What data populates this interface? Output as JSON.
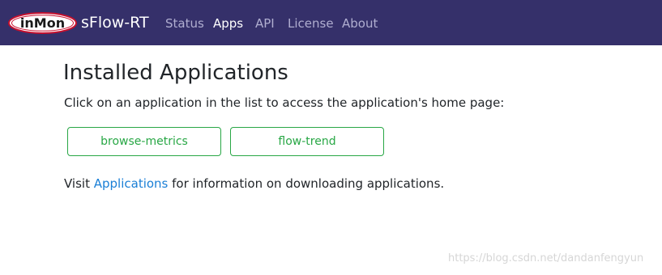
{
  "navbar": {
    "logo_text": "inMon",
    "brand": "sFlow-RT",
    "items": [
      {
        "label": "Status",
        "active": false
      },
      {
        "label": "Apps",
        "active": true
      },
      {
        "label": "API",
        "active": false
      },
      {
        "label": "License",
        "active": false
      },
      {
        "label": "About",
        "active": false
      }
    ]
  },
  "main": {
    "title": "Installed Applications",
    "intro": "Click on an application in the list to access the application's home page:",
    "apps": [
      {
        "label": "browse-metrics"
      },
      {
        "label": "flow-trend"
      }
    ],
    "footer": {
      "prefix": "Visit ",
      "link_label": "Applications",
      "suffix": " for information on downloading applications."
    }
  },
  "watermark": "https://blog.csdn.net/dandanfengyun",
  "colors": {
    "navbar_bg": "#35306a",
    "nav_inactive": "#b0aed0",
    "nav_active": "#ffffff",
    "app_button": "#28a745",
    "link": "#1a7fd6",
    "logo_red": "#c8102e"
  }
}
